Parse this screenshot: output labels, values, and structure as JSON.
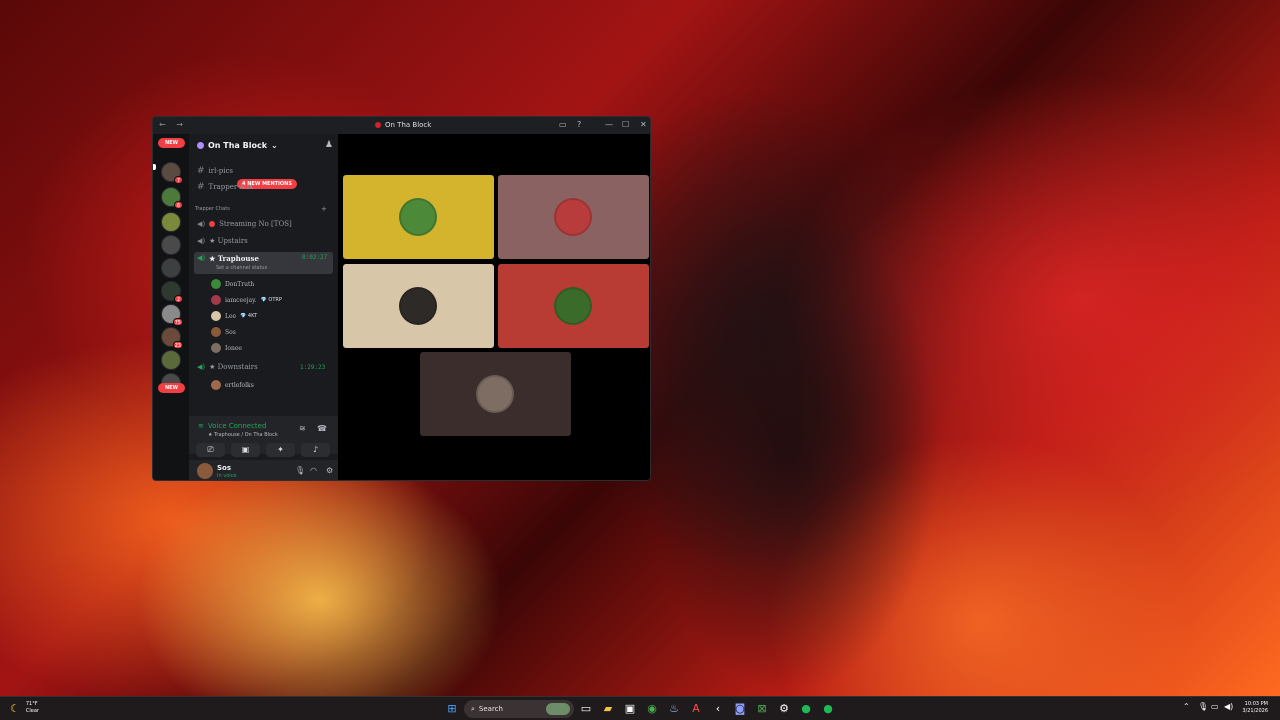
{
  "window": {
    "title": "On Tha Block",
    "nav": "← →",
    "controls": {
      "inbox": "▭",
      "help": "?",
      "minimize": "—",
      "maximize": "☐",
      "close": "✕"
    }
  },
  "guilds": {
    "new_top": "NEW",
    "new_bottom": "NEW",
    "badges": [
      "7",
      "6",
      "2",
      "75",
      "23"
    ]
  },
  "server": {
    "name": "On Tha Block",
    "chevron": "⌄",
    "mentions_pill": "4 NEW MENTIONS"
  },
  "channels": {
    "irl_pics": "irl-pics",
    "trapper_aux": "Trapper-Aux",
    "category": "Trapper Chats",
    "streaming": "Streaming No  [TOS]",
    "upstairs": "★ Upstairs",
    "traphouse": "★ Traphouse",
    "traphouse_timer": "8:02:27",
    "traphouse_status": "Set a channel status",
    "downstairs": "★ Downstairs",
    "downstairs_timer": "1:29:23"
  },
  "voice_users": {
    "traphouse": [
      {
        "name": "DonTruth",
        "tag": ""
      },
      {
        "name": "iamceejay.",
        "tag": "💎 OTRP"
      },
      {
        "name": "Lee",
        "tag": "💎 4KT"
      },
      {
        "name": "Sos",
        "tag": ""
      },
      {
        "name": "Ionee",
        "tag": ""
      }
    ],
    "downstairs": [
      {
        "name": "ertlefolks",
        "tag": ""
      }
    ]
  },
  "voice_panel": {
    "title": "Voice Connected",
    "subtitle": "★ Traphouse / On Tha Block"
  },
  "user_panel": {
    "name": "Sos",
    "status": "In voice"
  },
  "stage_tiles": [
    {
      "color": "#d4b42c",
      "avatar": "#4c8a3a"
    },
    {
      "color": "#8a6262",
      "avatar": "#b83c3c"
    },
    {
      "color": "#d8c6a8",
      "avatar": "#2e2a28"
    },
    {
      "color": "#b93c34",
      "avatar": "#3b6b2a"
    },
    {
      "color": "#3b2d2b",
      "avatar": "#7d6d63"
    }
  ],
  "taskbar": {
    "temperature": "71°F",
    "weather": "Clear",
    "search": "Search",
    "time": "10:03 PM",
    "date": "3/21/2026"
  },
  "colors": {
    "accent_green": "#23a55a",
    "badge_red": "#f23f43"
  }
}
